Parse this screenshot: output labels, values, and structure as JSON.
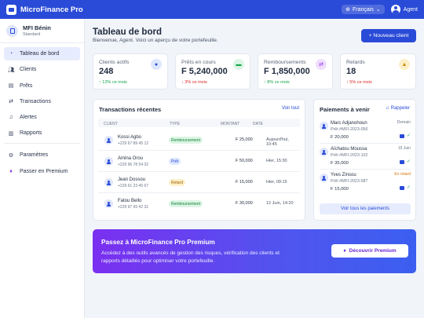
{
  "app": {
    "title": "MicroFinance Pro",
    "language": "Français",
    "user": "Agent"
  },
  "org": {
    "name": "MFI Bénin",
    "plan": "Standard"
  },
  "sidebar": {
    "items": [
      {
        "label": "Tableau de bord",
        "icon": "dashboard-icon"
      },
      {
        "label": "Clients",
        "icon": "users-icon"
      },
      {
        "label": "Prêts",
        "icon": "document-icon"
      },
      {
        "label": "Transactions",
        "icon": "exchange-icon"
      },
      {
        "label": "Alertes",
        "icon": "bell-icon"
      },
      {
        "label": "Rapports",
        "icon": "chart-icon"
      }
    ],
    "bottom": [
      {
        "label": "Paramètres",
        "icon": "gear-icon"
      },
      {
        "label": "Passer en Premium",
        "icon": "gem-icon"
      }
    ]
  },
  "header": {
    "title": "Tableau de bord",
    "subtitle": "Bienvenue, Agent. Voici un aperçu de votre portefeuille.",
    "new_client_label": "+ Nouveau client"
  },
  "stats": [
    {
      "label": "Clients actifs",
      "value": "248",
      "trend": "↑ 12% ce mois",
      "direction": "up",
      "icon": "users-icon",
      "icon_bg": "#dde7fd",
      "icon_color": "#2a4bd7"
    },
    {
      "label": "Prêts en cours",
      "value": "F 5,240,000",
      "trend": "↓ 3% ce mois",
      "direction": "down",
      "icon": "money-icon",
      "icon_bg": "#dcf5e4",
      "icon_color": "#16a34a"
    },
    {
      "label": "Remboursements",
      "value": "F 1,850,000",
      "trend": "↑ 8% ce mois",
      "direction": "up",
      "icon": "exchange-icon",
      "icon_bg": "#f0defd",
      "icon_color": "#9333ea"
    },
    {
      "label": "Retards",
      "value": "18",
      "trend": "↑ 5% ce mois",
      "direction": "down",
      "icon": "warning-icon",
      "icon_bg": "#fdf0c8",
      "icon_color": "#ca8a04"
    }
  ],
  "transactions": {
    "title": "Transactions récentes",
    "link": "Voir tout",
    "columns": [
      "CLIENT",
      "TYPE",
      "MONTANT",
      "DATE"
    ],
    "rows": [
      {
        "name": "Kossi Agbo",
        "phone": "+229 67 89 45 12",
        "type": "Remboursement",
        "type_color": "green",
        "amount": "F 25,000",
        "date": "Aujourd'hui, 10:45"
      },
      {
        "name": "Amina Orou",
        "phone": "+229 96 78 54 32",
        "type": "Prêt",
        "type_color": "blue",
        "amount": "F 50,000",
        "date": "Hier, 15:30"
      },
      {
        "name": "Jean Dossou",
        "phone": "+229 61 23 45 67",
        "type": "Retard",
        "type_color": "yellow",
        "amount": "F 15,000",
        "date": "Hier, 09:15"
      },
      {
        "name": "Fatou Bello",
        "phone": "+229 97 65 42 31",
        "type": "Remboursement",
        "type_color": "green",
        "amount": "F 30,000",
        "date": "12 Juin, 14:20"
      }
    ]
  },
  "payments": {
    "title": "Paiements à venir",
    "remind_label": "Rappeler",
    "items": [
      {
        "name": "Marc Adjanohoun",
        "loan": "Prêt #MFI-2023-056",
        "amount": "F 20,000",
        "when": "Demain",
        "late": false
      },
      {
        "name": "Aïchatou Moussa",
        "loan": "Prêt #MFI-2023-102",
        "amount": "F 35,000",
        "when": "15 Juin",
        "late": false
      },
      {
        "name": "Yves Zinsou",
        "loan": "Prêt #MFI-2023-087",
        "amount": "F 15,000",
        "when": "En retard",
        "late": true
      }
    ],
    "all_label": "Voir tous les paiements"
  },
  "premium": {
    "title": "Passez à MicroFinance Pro Premium",
    "text": "Accédez à des outils avancés de gestion des risques, vérification des clients et rapports détaillés pour optimiser votre portefeuille.",
    "button": "Découvrir Premium"
  }
}
